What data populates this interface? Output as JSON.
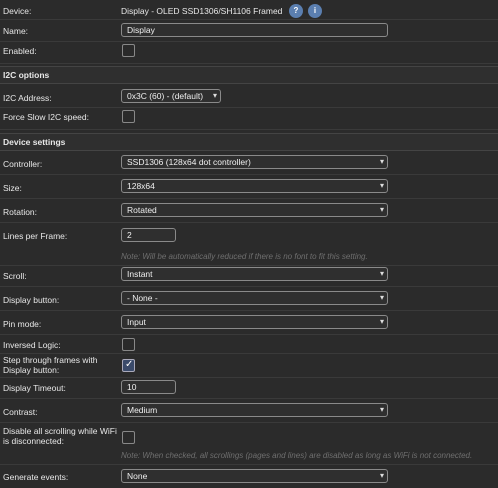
{
  "device": {
    "label": "Device:",
    "value": "Display - OLED SSD1306/SH1106 Framed",
    "help_icon": "?",
    "info_icon": "i"
  },
  "name": {
    "label": "Name:",
    "value": "Display"
  },
  "enabled": {
    "label": "Enabled:",
    "checked": false
  },
  "i2c": {
    "title": "I2C options",
    "address_label": "I2C Address:",
    "address_value": "0x3C (60) - (default)",
    "slow_label": "Force Slow I2C speed:",
    "slow_checked": false
  },
  "settings": {
    "title": "Device settings",
    "controller_label": "Controller:",
    "controller_value": "SSD1306 (128x64 dot controller)",
    "size_label": "Size:",
    "size_value": "128x64",
    "rotation_label": "Rotation:",
    "rotation_value": "Rotated",
    "lines_label": "Lines per Frame:",
    "lines_value": "2",
    "lines_note": "Note: Will be automatically reduced if there is no font to fit this setting.",
    "scroll_label": "Scroll:",
    "scroll_value": "Instant",
    "display_button_label": "Display button:",
    "display_button_value": "- None -",
    "pin_mode_label": "Pin mode:",
    "pin_mode_value": "Input",
    "inversed_label": "Inversed Logic:",
    "inversed_checked": false,
    "step_label_1": "Step through frames with",
    "step_label_2": "Display button:",
    "step_checked": true,
    "timeout_label": "Display Timeout:",
    "timeout_value": "10",
    "contrast_label": "Contrast:",
    "contrast_value": "Medium",
    "disable_label_1": "Disable all scrolling while WiFi",
    "disable_label_2": "is disconnected:",
    "disable_checked": false,
    "disable_note": "Note: When checked, all scrollings (pages and lines) are disabled as long as WiFi is not connected.",
    "events_label": "Generate events:",
    "events_value": "None"
  }
}
